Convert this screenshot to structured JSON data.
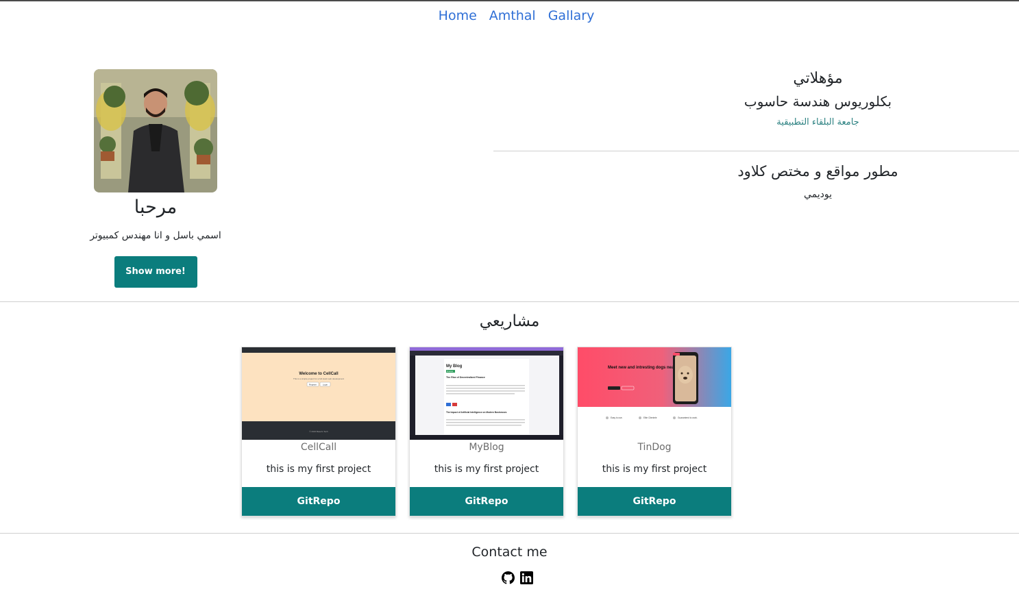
{
  "nav": {
    "links": [
      "Home",
      "Amthal",
      "Gallary"
    ]
  },
  "profile": {
    "greeting": "مرحبا",
    "intro": "اسمي باسل و انا مهندس كمبيوتر",
    "button": "Show more!"
  },
  "qualifications": {
    "title": "مؤهلاتي",
    "degree": "بكلوريوس هندسة حاسوب",
    "university": "جامعة البلقاء التطبيقية",
    "job": "مطور مواقع و مختص كلاود",
    "company": "يوديمي"
  },
  "projects": {
    "title": "مشاريعي",
    "items": [
      {
        "name": "CellCall",
        "description": "this is my first project",
        "button": "GitRepo",
        "thumb": {
          "heading": "Welcome to CellCall",
          "sub": "This is a simple project for a full stack web development",
          "btn1": "Register",
          "btn2": "Login",
          "footer": "© 2023 Basel's Tech"
        }
      },
      {
        "name": "MyBlog",
        "description": "this is my first project",
        "button": "GitRepo",
        "thumb": {
          "heading": "My Blog",
          "badge": "Finance",
          "post1": "The Rise of Decentralized Finance",
          "post2": "The Impact of Artificial Intelligence on Modern Businesses"
        }
      },
      {
        "name": "TinDog",
        "description": "this is my first project",
        "button": "GitRepo",
        "thumb": {
          "heading": "Meet new and intresting dogs nearby!",
          "f1": "Easy to use.",
          "f2": "Elite Clientele",
          "f3": "Guaranteed to work."
        }
      }
    ]
  },
  "contact": {
    "title": "Contact me",
    "icons": [
      "github-icon",
      "linkedin-icon"
    ]
  },
  "colors": {
    "accent": "#0b7d7d",
    "link": "#2f6fd6"
  }
}
